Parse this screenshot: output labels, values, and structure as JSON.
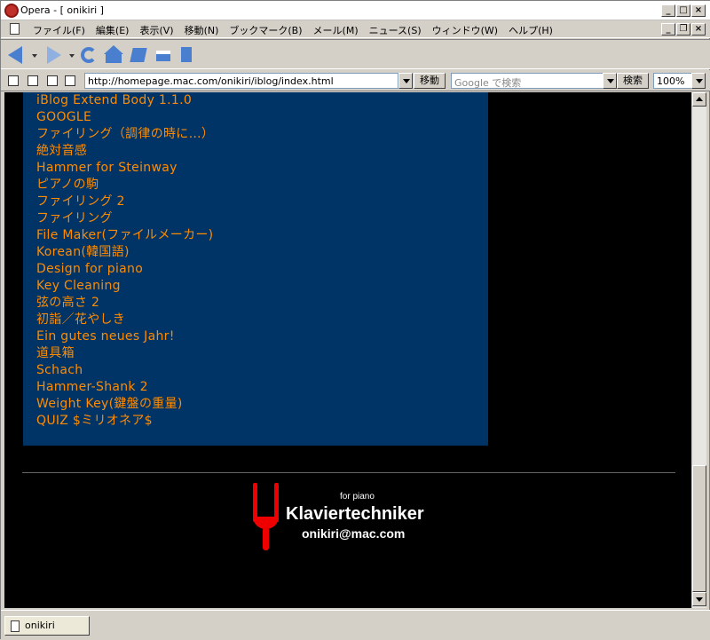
{
  "window": {
    "title": "Opera - [ onikiri ]"
  },
  "menu": {
    "items": [
      "ファイル(F)",
      "編集(E)",
      "表示(V)",
      "移動(N)",
      "ブックマーク(B)",
      "メール(M)",
      "ニュース(S)",
      "ウィンドウ(W)",
      "ヘルプ(H)"
    ]
  },
  "toolbar": {
    "icons": [
      "back-icon",
      "forward-icon",
      "reload-icon",
      "home-icon",
      "bookmarks-icon",
      "print-icon",
      "page-icon"
    ]
  },
  "address": {
    "url": "http://homepage.mac.com/onikiri/iblog/index.html",
    "go_label": "移動",
    "search_placeholder": "Google で検索",
    "search_label": "検索",
    "zoom": "100%"
  },
  "page": {
    "links": [
      "iBlog Extend Body 1.1.0",
      "GOOGLE",
      "ファイリング（調律の時に…）",
      "絶対音感",
      "Hammer for Steinway",
      "ピアノの駒",
      "ファイリング 2",
      "ファイリング",
      "File Maker(ファイルメーカー)",
      "Korean(韓国語)",
      "Design for piano",
      "Key Cleaning",
      "弦の高さ 2",
      "初詣／花やしき",
      "Ein gutes neues Jahr!",
      "道具箱",
      "Schach",
      "Hammer-Shank 2",
      "Weight Key(鍵盤の重量)",
      "QUIZ $ミリオネア$"
    ],
    "footer": {
      "tagline": "for piano",
      "brand": "Klaviertechniker",
      "email": "onikiri@mac.com"
    }
  },
  "statusbar": {
    "tab_label": "onikiri"
  },
  "colors": {
    "link": "#ff8c00",
    "panel": "#003366",
    "page_bg": "#000000",
    "logo": "#ee0000"
  }
}
